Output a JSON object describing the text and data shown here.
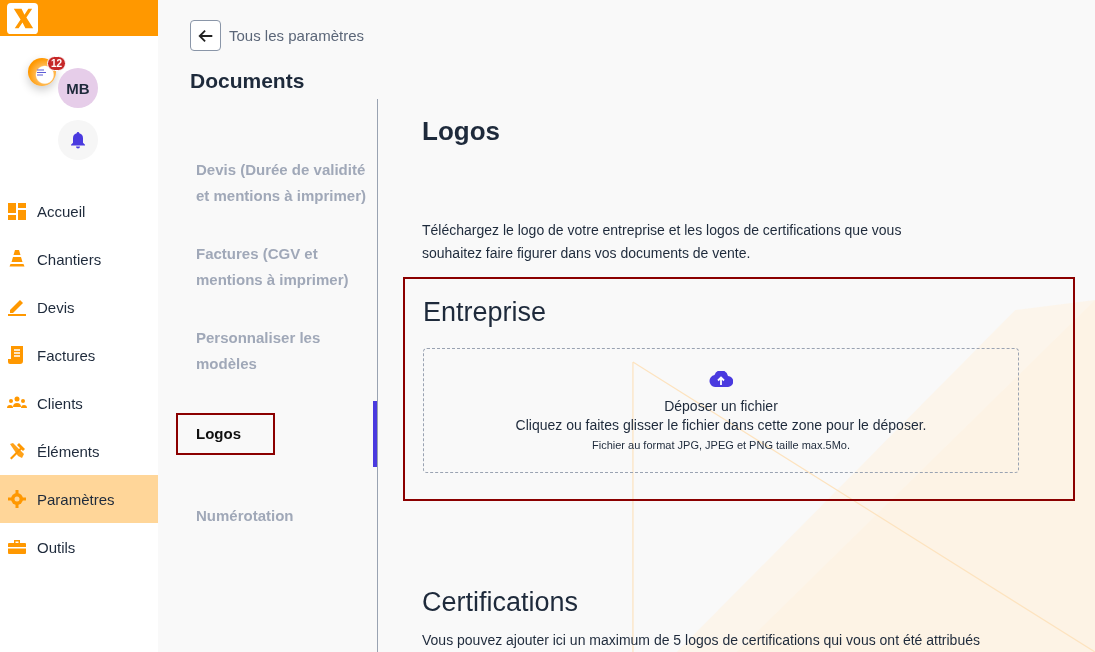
{
  "sidebar": {
    "notification_count": "12",
    "avatar_initials": "MB",
    "items": [
      {
        "label": "Accueil",
        "selected": false
      },
      {
        "label": "Chantiers",
        "selected": false
      },
      {
        "label": "Devis",
        "selected": false
      },
      {
        "label": "Factures",
        "selected": false
      },
      {
        "label": "Clients",
        "selected": false
      },
      {
        "label": "Éléments",
        "selected": false
      },
      {
        "label": "Paramètres",
        "selected": true
      },
      {
        "label": "Outils",
        "selected": false
      }
    ]
  },
  "settings_nav": {
    "back_label": "Tous les paramètres",
    "title": "Documents",
    "items": [
      {
        "label": "Devis (Durée de validité et mentions à imprimer)",
        "selected": false,
        "highlighted": false
      },
      {
        "label": "Factures (CGV et mentions à imprimer)",
        "selected": false,
        "highlighted": false
      },
      {
        "label": "Personnaliser les modèles",
        "selected": false,
        "highlighted": false
      },
      {
        "label": "Logos",
        "selected": true,
        "highlighted": true
      },
      {
        "label": "Numérotation",
        "selected": false,
        "highlighted": false
      }
    ]
  },
  "content": {
    "title": "Logos",
    "intro": "Téléchargez le logo de votre entreprise et les logos de certifications que vous souhaitez faire figurer dans vos documents de vente.",
    "company": {
      "heading": "Entreprise",
      "highlighted": true,
      "dropzone": {
        "title": "Déposer un fichier",
        "instruction": "Cliquez ou faites glisser le fichier dans cette zone pour le déposer.",
        "hint": "Fichier au format JPG, JPEG et PNG taille max.5Mo."
      }
    },
    "certifications": {
      "heading": "Certifications",
      "text": "Vous pouvez ajouter ici un maximum de 5 logos de certifications qui vous ont été attribués"
    }
  }
}
